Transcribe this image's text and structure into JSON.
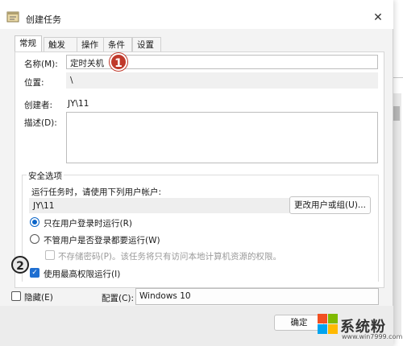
{
  "window": {
    "title": "创建任务",
    "close_glyph": "✕"
  },
  "tabs": [
    {
      "label": "常规",
      "active": true
    },
    {
      "label": "触发器",
      "active": false
    },
    {
      "label": "操作",
      "active": false
    },
    {
      "label": "条件",
      "active": false
    },
    {
      "label": "设置",
      "active": false
    }
  ],
  "general": {
    "name_label": "名称(M):",
    "name_value": "定时关机",
    "location_label": "位置:",
    "location_value": "\\",
    "author_label": "创建者:",
    "author_value": "JY\\11",
    "description_label": "描述(D):",
    "description_value": ""
  },
  "security": {
    "section_title": "安全选项",
    "run_as_prompt": "运行任务时，请使用下列用户帐户:",
    "account_value": "JY\\11",
    "change_user_button": "更改用户或组(U)...",
    "radio_logged_on": "只在用户登录时运行(R)",
    "radio_whether_logged": "不管用户是否登录都要运行(W)",
    "no_store_password": "不存储密码(P)。该任务将只有访问本地计算机资源的权限。",
    "highest_privileges": "使用最高权限运行(I)"
  },
  "bottom": {
    "hidden_label": "隐藏(E)",
    "configure_label": "配置(C):",
    "configure_value": "Windows 10",
    "ok_button": "确定"
  },
  "annotations": {
    "badge1": "1",
    "badge2": "2"
  },
  "watermark": {
    "text": "系统粉",
    "url": "www.win7999.com"
  },
  "colors": {
    "accent": "#0a64c8",
    "badge_red": "#c0392b"
  }
}
